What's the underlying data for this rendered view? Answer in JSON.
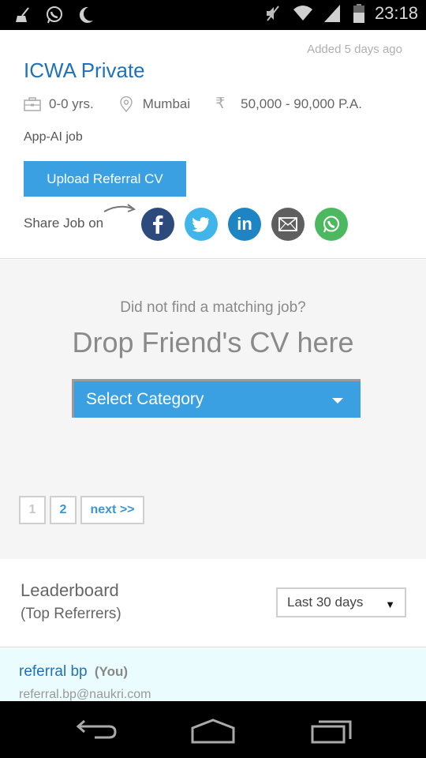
{
  "status_bar": {
    "left_icons": [
      "cleaner-icon",
      "whatsapp-icon",
      "moon-icon"
    ],
    "right_icons": [
      "mute-icon",
      "wifi-icon",
      "signal-icon",
      "battery-icon"
    ],
    "time": "23:18"
  },
  "job": {
    "added": "Added 5 days ago",
    "company": "ICWA Private",
    "experience": "0-0 yrs.",
    "location": "Mumbai",
    "salary": "50,000 - 90,000 P.A.",
    "description": "App-AI job",
    "upload_button": "Upload Referral CV",
    "share_label": "Share Job on",
    "share_targets": [
      "Facebook",
      "Twitter",
      "LinkedIn",
      "Email",
      "WhatsApp"
    ]
  },
  "drop": {
    "question": "Did not find a matching job?",
    "title": "Drop Friend's CV here",
    "category_select": "Select Category"
  },
  "pagination": {
    "pages": [
      "1",
      "2"
    ],
    "current": "1",
    "next": "next >>"
  },
  "leaderboard": {
    "title": "Leaderboard",
    "subtitle": "(Top Referrers)",
    "period": "Last 30 days",
    "entries": [
      {
        "name": "referral bp",
        "tag": "(You)",
        "email": "referral.bp@naukri.com"
      }
    ]
  },
  "colors": {
    "brand_blue": "#3aa0e2",
    "link_blue": "#1f72b8",
    "facebook": "#2d4a7c",
    "twitter": "#3fb5ea",
    "linkedin": "#1e85c4",
    "email": "#5f5f5f",
    "whatsapp": "#4cb960"
  }
}
